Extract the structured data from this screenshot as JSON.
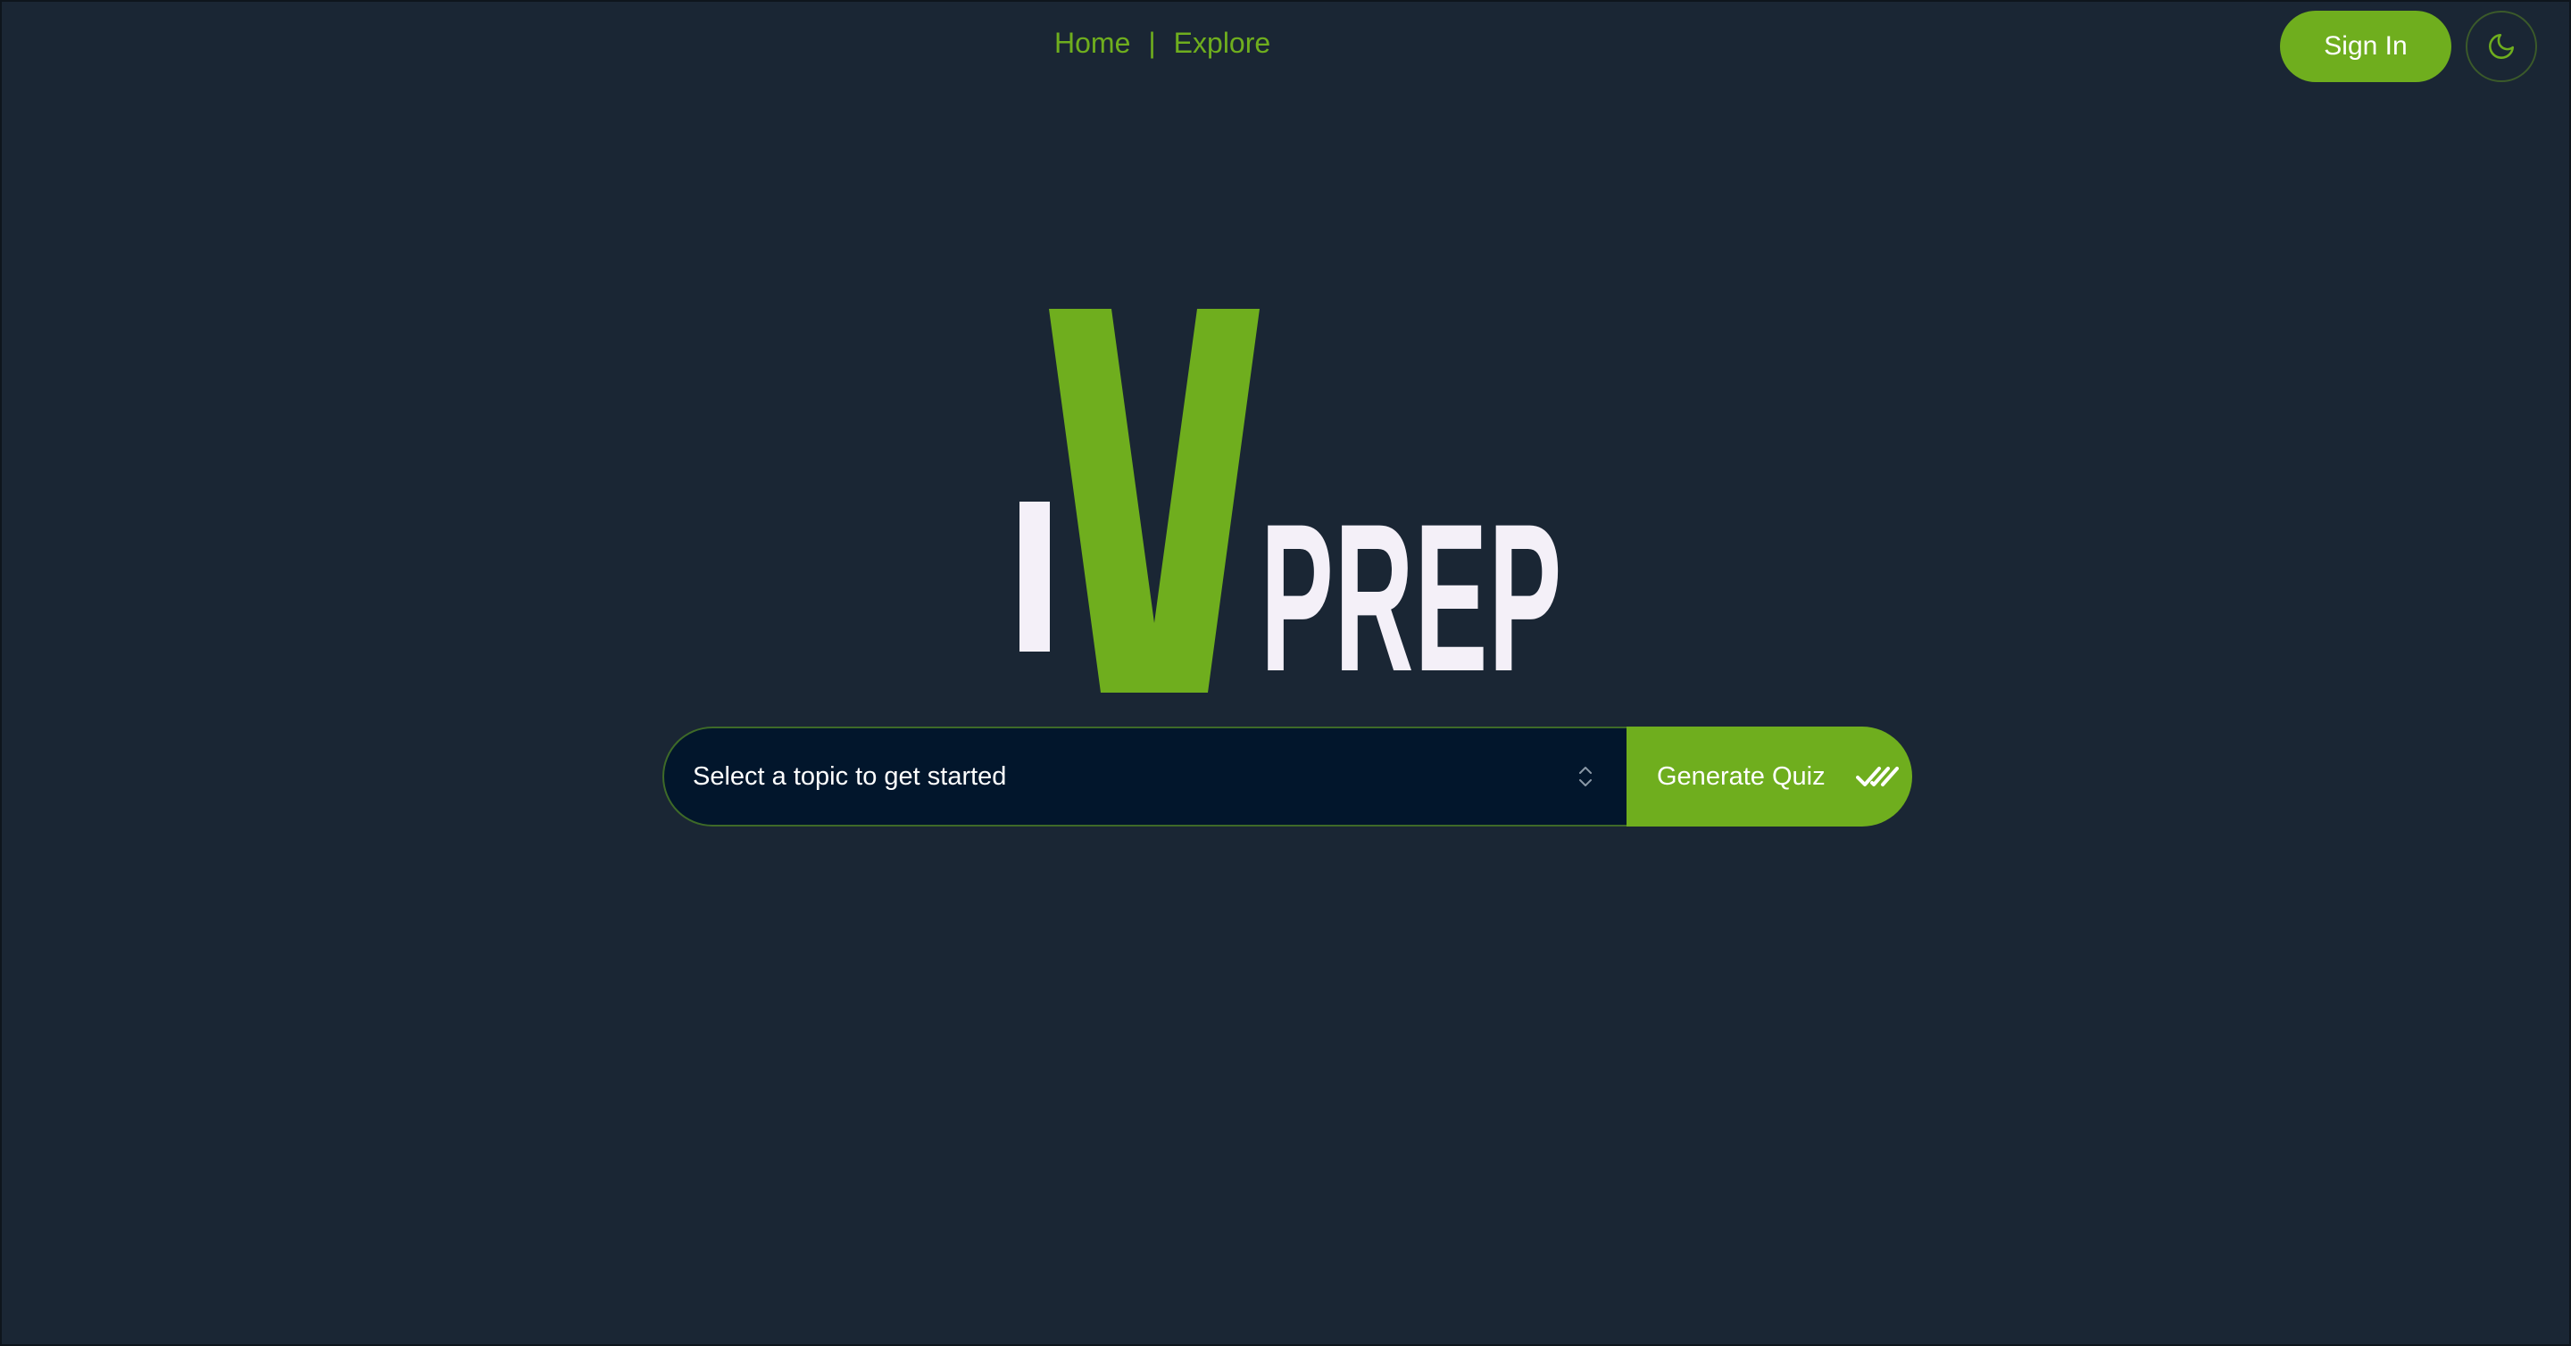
{
  "nav": {
    "home_label": "Home",
    "separator": "|",
    "explore_label": "Explore"
  },
  "header": {
    "signin_label": "Sign In",
    "theme_icon": "moon-icon"
  },
  "logo": {
    "letter_i": "I",
    "letter_v": "V",
    "word": "PREP"
  },
  "search": {
    "placeholder": "Select a topic to get started",
    "select_icon": "chevron-up-down-icon",
    "generate_label": "Generate Quiz",
    "generate_icon": "double-check-icon"
  },
  "colors": {
    "background": "#1a2634",
    "accent": "#6fae1e",
    "input_bg": "#02162c",
    "logo_text": "#f4f0f8"
  }
}
